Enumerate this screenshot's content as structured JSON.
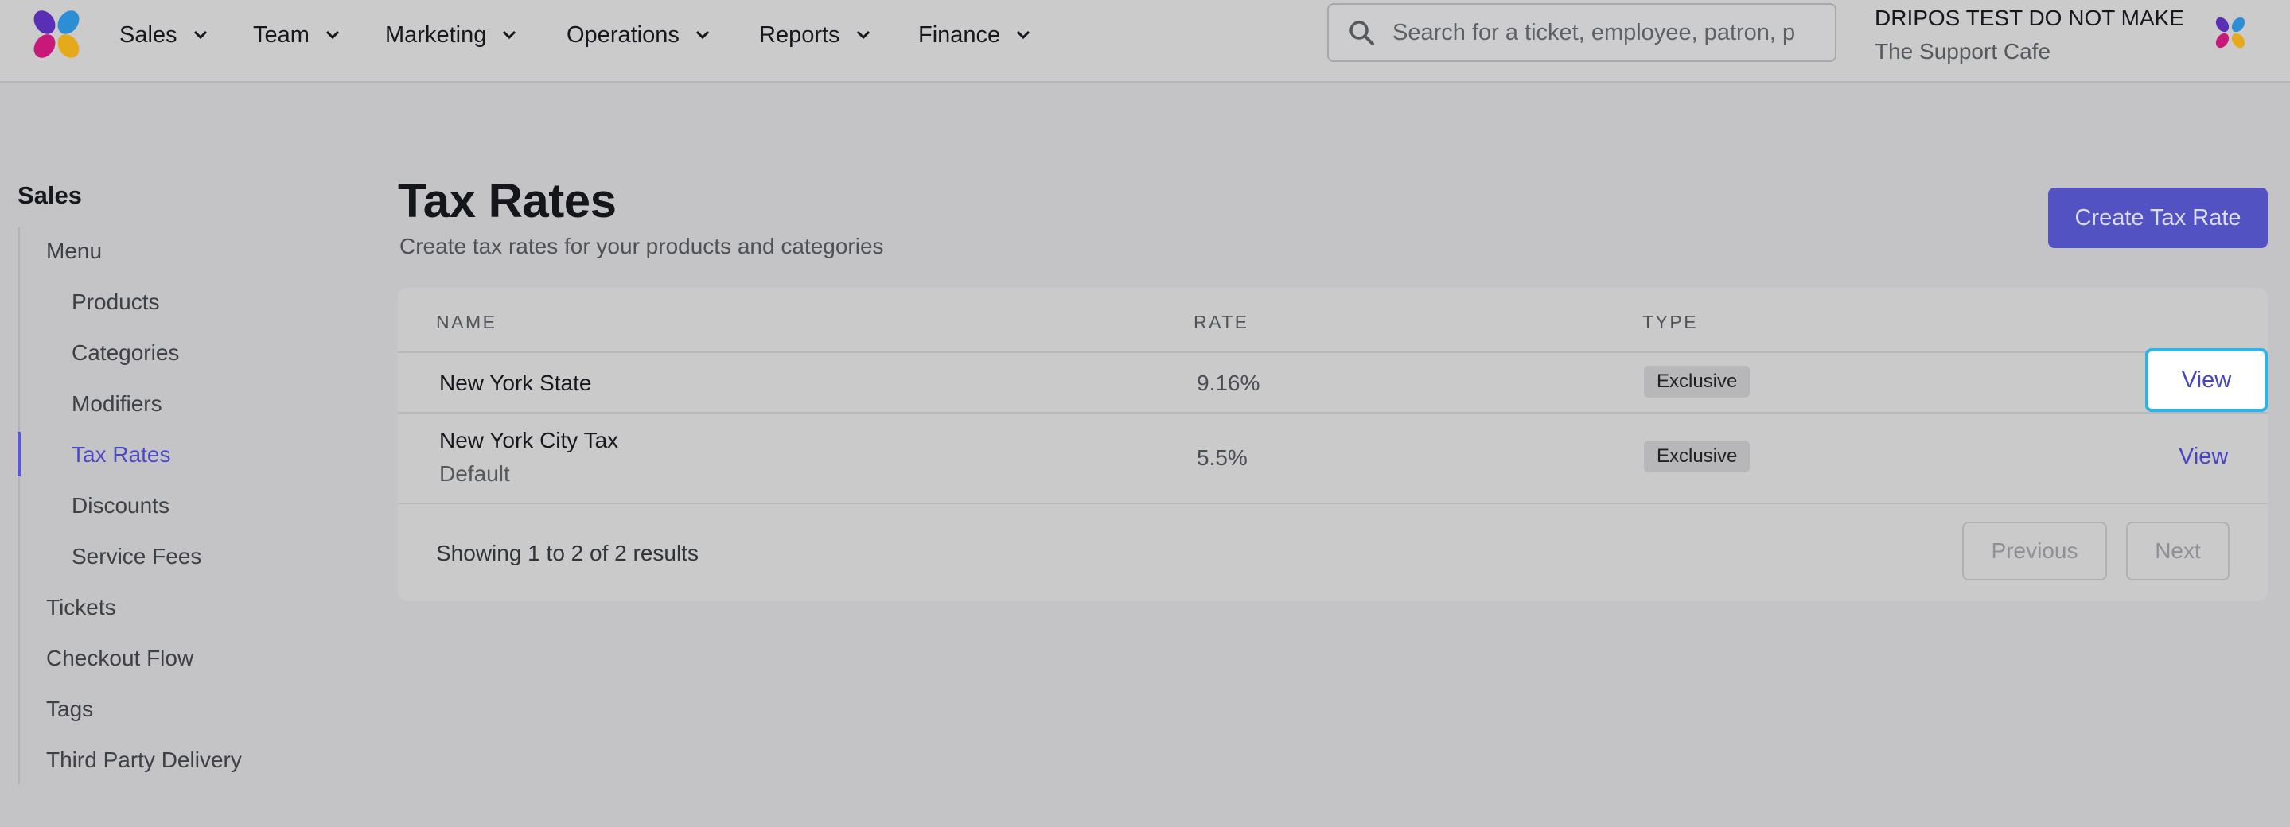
{
  "nav": {
    "items": [
      {
        "label": "Sales"
      },
      {
        "label": "Team"
      },
      {
        "label": "Marketing"
      },
      {
        "label": "Operations"
      },
      {
        "label": "Reports"
      },
      {
        "label": "Finance"
      }
    ],
    "search_placeholder": "Search for a ticket, employee, patron, p",
    "account_name": "DRIPOS TEST DO NOT MAKE",
    "account_location": "The Support Cafe"
  },
  "sidebar": {
    "title": "Sales",
    "items": [
      {
        "label": "Menu",
        "level": "top"
      },
      {
        "label": "Products",
        "level": "sub"
      },
      {
        "label": "Categories",
        "level": "sub"
      },
      {
        "label": "Modifiers",
        "level": "sub"
      },
      {
        "label": "Tax Rates",
        "level": "sub",
        "active": true
      },
      {
        "label": "Discounts",
        "level": "sub"
      },
      {
        "label": "Service Fees",
        "level": "sub"
      },
      {
        "label": "Tickets",
        "level": "top"
      },
      {
        "label": "Checkout Flow",
        "level": "top"
      },
      {
        "label": "Tags",
        "level": "top"
      },
      {
        "label": "Third Party Delivery",
        "level": "top"
      }
    ]
  },
  "main": {
    "title": "Tax Rates",
    "subtitle": "Create tax rates for your products and categories",
    "create_label": "Create Tax Rate",
    "table": {
      "headers": {
        "name": "NAME",
        "rate": "RATE",
        "type": "TYPE"
      },
      "rows": [
        {
          "name": "New York State",
          "sub": "",
          "rate": "9.16%",
          "type": "Exclusive",
          "action": "View"
        },
        {
          "name": "New York City Tax",
          "sub": "Default",
          "rate": "5.5%",
          "type": "Exclusive",
          "action": "View"
        }
      ]
    },
    "pagination": {
      "summary": "Showing 1 to 2 of 2 results",
      "previous_label": "Previous",
      "next_label": "Next"
    }
  },
  "colors": {
    "accent": "#5352c3",
    "focus_ring": "#2fb3e6",
    "logo_blue": "#2c8fd6",
    "logo_magenta": "#c8197a",
    "logo_yellow": "#e5a91c",
    "logo_purple": "#5a2fb5"
  }
}
